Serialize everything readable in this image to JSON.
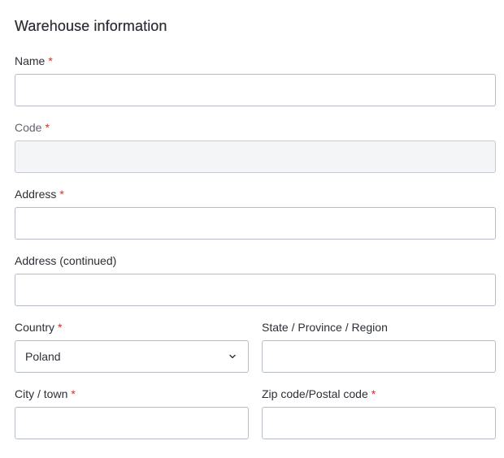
{
  "section": {
    "title": "Warehouse information"
  },
  "fields": {
    "name": {
      "label": "Name",
      "required_mark": "*",
      "value": ""
    },
    "code": {
      "label": "Code",
      "required_mark": "*",
      "value": ""
    },
    "address": {
      "label": "Address",
      "required_mark": "*",
      "value": ""
    },
    "address_continued": {
      "label": "Address (continued)",
      "value": ""
    },
    "country": {
      "label": "Country",
      "required_mark": "*",
      "selected": "Poland"
    },
    "state": {
      "label": "State / Province / Region",
      "value": ""
    },
    "city": {
      "label": "City / town",
      "required_mark": "*",
      "value": ""
    },
    "zip": {
      "label": "Zip code/Postal code",
      "required_mark": "*",
      "value": ""
    }
  },
  "icons": {
    "country_dropdown": "chevron-down-icon"
  },
  "colors": {
    "required": "#c0392b",
    "border": "#b6bcc4",
    "disabled_bg": "#f4f5f6"
  }
}
